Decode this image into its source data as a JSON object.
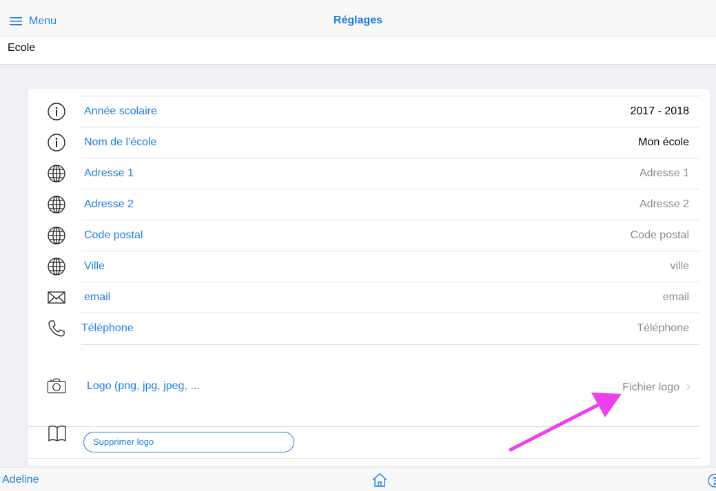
{
  "header": {
    "menu_label": "Menu",
    "title": "Réglages"
  },
  "section": {
    "title": "Ecole"
  },
  "settings": {
    "rows": [
      {
        "icon": "info-icon",
        "label": "Année scolaire",
        "value": "2017 - 2018"
      },
      {
        "icon": "info-icon",
        "label": "Nom de l'école",
        "value": "Mon école"
      },
      {
        "icon": "globe-icon",
        "label": "Adresse 1",
        "value": "Adresse 1"
      },
      {
        "icon": "globe-icon",
        "label": "Adresse 2",
        "value": "Adresse 2"
      },
      {
        "icon": "globe-icon",
        "label": "Code postal",
        "value": "Code postal"
      },
      {
        "icon": "globe-icon",
        "label": "Ville",
        "value": "ville"
      },
      {
        "icon": "mail-icon",
        "label": "email",
        "value": "email"
      },
      {
        "icon": "phone-icon",
        "label": "Téléphone",
        "value": "Téléphone"
      }
    ],
    "logo": {
      "icon": "camera-icon",
      "label": "Logo (png, jpg, jpeg, ...",
      "value": "Fichier logo"
    },
    "delete": {
      "icon": "book-icon",
      "label": "Supprimer logo"
    }
  },
  "footer": {
    "user": "Adeline",
    "home_icon": "home-icon",
    "help_icon": "help-icon"
  },
  "colors": {
    "accent": "#1e7ee0",
    "annotation_arrow": "#ee3fee"
  }
}
